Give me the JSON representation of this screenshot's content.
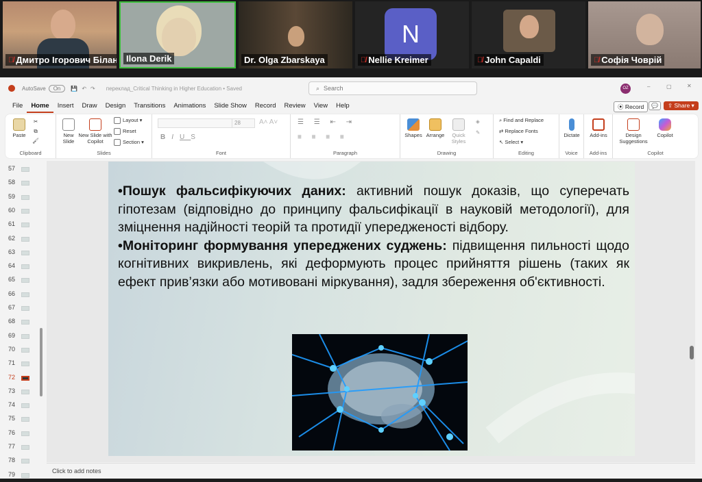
{
  "participants": [
    {
      "name": "Дмитро Ігорович Білан",
      "muted": true
    },
    {
      "name": "Ilona Derik",
      "muted": false,
      "speaking": true
    },
    {
      "name": "Dr. Olga Zbarskaya",
      "muted": false
    },
    {
      "name": "Nellie Kreimer",
      "muted": true,
      "avatar_letter": "N"
    },
    {
      "name": "John Capaldi",
      "muted": true
    },
    {
      "name": "Софія Човрій",
      "muted": true
    }
  ],
  "titlebar": {
    "autosave": "AutoSave",
    "autosave_state": "On",
    "document": "переклад_Critical Thinking in Higher Education • Saved",
    "search_placeholder": "Search",
    "user_initials": "OZ"
  },
  "menu": {
    "tabs": [
      "File",
      "Home",
      "Insert",
      "Draw",
      "Design",
      "Transitions",
      "Animations",
      "Slide Show",
      "Record",
      "Review",
      "View",
      "Help"
    ],
    "active": "Home",
    "record_label": "Record",
    "share_label": "Share"
  },
  "ribbon": {
    "clipboard": {
      "label": "Clipboard",
      "paste": "Paste"
    },
    "slides": {
      "label": "Slides",
      "new_slide": "New Slide",
      "new_slide_copilot": "New Slide with Copilot",
      "layout": "Layout",
      "reset": "Reset",
      "section": "Section"
    },
    "font": {
      "label": "Font",
      "size": "28"
    },
    "paragraph": {
      "label": "Paragraph"
    },
    "drawing": {
      "label": "Drawing",
      "shapes": "Shapes",
      "arrange": "Arrange",
      "quick_styles": "Quick Styles"
    },
    "editing": {
      "label": "Editing",
      "find_replace": "Find and Replace",
      "replace_fonts": "Replace Fonts",
      "select": "Select"
    },
    "voice": {
      "label": "Voice",
      "dictate": "Dictate"
    },
    "addins": {
      "label": "Add-ins",
      "addins": "Add-ins"
    },
    "copilot": {
      "label": "Copilot",
      "design_suggestions": "Design Suggestions",
      "copilot": "Copilot"
    }
  },
  "thumbnails": [
    "57",
    "58",
    "59",
    "60",
    "61",
    "62",
    "63",
    "64",
    "65",
    "66",
    "67",
    "68",
    "69",
    "70",
    "71",
    "72",
    "73",
    "74",
    "75",
    "76",
    "77",
    "78",
    "79"
  ],
  "selected_slide": "72",
  "slide": {
    "p1_bold": "•Пошук фальсифікуючих даних:",
    "p1_text": " активний пошук доказів, що суперечать гіпотезам (відповідно до принципу фальсифікації в науковій методології), для зміцнення надійності теорій та протидії упередженості відбору.",
    "p2_bold": "•Моніторинг формування упереджених суджень:",
    "p2_text": " підвищення пильності щодо когнітивних викривлень, які деформують процес прийняття рішень (таких як ефект прив’язки або мотивовані міркування), задля збереження об'єктивності.",
    "image": "brain-neurons-image"
  },
  "notes": {
    "placeholder": "Click to add notes"
  },
  "colors": {
    "accent": "#c43e1c",
    "speaking_border": "#3bbf3b",
    "avatar_bg": "#5a5fc6"
  }
}
